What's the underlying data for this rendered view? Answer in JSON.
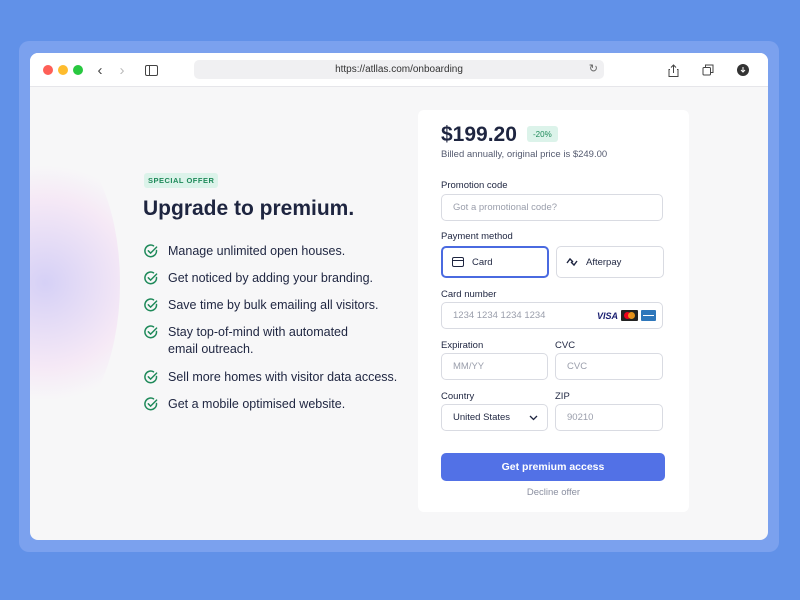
{
  "browser": {
    "url": "https://atllas.com/onboarding"
  },
  "hero": {
    "badge": "SPECIAL OFFER",
    "title": "Upgrade to premium.",
    "features": [
      "Manage unlimited open houses.",
      "Get noticed by adding your branding.",
      "Save time by bulk emailing all visitors.",
      "Stay top-of-mind with automated email outreach.",
      "Sell more homes with visitor data access.",
      "Get a mobile optimised website."
    ]
  },
  "checkout": {
    "price": "$199.20",
    "discount": "-20%",
    "billing_note": "Billed annually, original price is $249.00",
    "promo_label": "Promotion code",
    "promo_placeholder": "Got a promotional code?",
    "payment_label": "Payment method",
    "methods": [
      "Card",
      "Afterpay"
    ],
    "selected_method": "Card",
    "card_label": "Card number",
    "card_placeholder": "1234 1234 1234 1234",
    "card_brands": [
      "VISA",
      "Mastercard",
      "Amex"
    ],
    "exp_label": "Expiration",
    "exp_placeholder": "MM/YY",
    "cvc_label": "CVC",
    "cvc_placeholder": "CVC",
    "country_label": "Country",
    "country_value": "United States",
    "zip_label": "ZIP",
    "zip_placeholder": "90210",
    "cta": "Get premium access",
    "decline": "Decline offer"
  },
  "colors": {
    "accent": "#5271e6",
    "success": "#1f8a5a",
    "background": "#6191e8"
  }
}
